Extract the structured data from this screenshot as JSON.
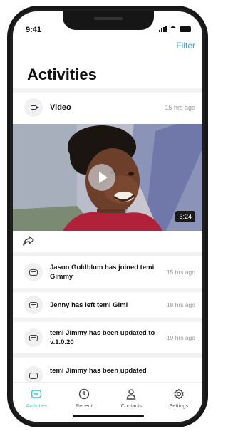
{
  "status_bar": {
    "time": "9:41"
  },
  "header": {
    "filter_label": "Filter",
    "title": "Activities"
  },
  "video_card": {
    "type_label": "Video",
    "time": "15 hrs ago",
    "duration": "3:24"
  },
  "activities": [
    {
      "text": "Jason Goldblum has joined temi Gimmy",
      "time": "15 hrs ago"
    },
    {
      "text": "Jenny has left temi Gimi",
      "time": "18 hrs ago"
    },
    {
      "text": "temi Jimmy has been updated to v.1.0.20",
      "time": "19 hrs ago"
    },
    {
      "text": "temi Jimmy has been updated",
      "time": ""
    }
  ],
  "tabs": [
    {
      "label": "Activities",
      "icon": "activities-icon",
      "active": true
    },
    {
      "label": "Recent",
      "icon": "clock-icon",
      "active": false
    },
    {
      "label": "Contacts",
      "icon": "person-icon",
      "active": false
    },
    {
      "label": "Settings",
      "icon": "gear-icon",
      "active": false
    }
  ],
  "colors": {
    "accent": "#3fc6c0",
    "link": "#3b9ad9",
    "feed_bg": "#f2f2f4"
  }
}
